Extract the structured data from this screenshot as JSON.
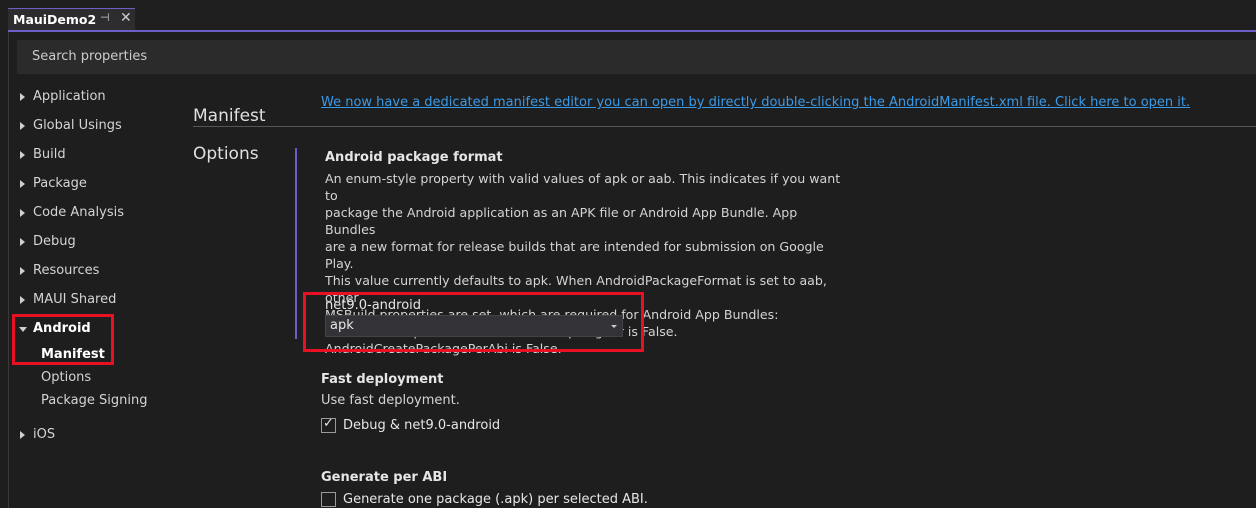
{
  "tab": {
    "title": "MauiDemo2",
    "pin_glyph": "⊣",
    "close_glyph": "✕"
  },
  "search": {
    "placeholder": "Search properties"
  },
  "sidebar": {
    "items": [
      {
        "label": "Application"
      },
      {
        "label": "Global Usings"
      },
      {
        "label": "Build"
      },
      {
        "label": "Package"
      },
      {
        "label": "Code Analysis"
      },
      {
        "label": "Debug"
      },
      {
        "label": "Resources"
      },
      {
        "label": "MAUI Shared"
      },
      {
        "label": "Android"
      },
      {
        "label": "iOS"
      }
    ],
    "android_children": [
      {
        "label": "Manifest"
      },
      {
        "label": "Options"
      },
      {
        "label": "Package Signing"
      }
    ]
  },
  "main": {
    "manifest": {
      "heading": "Manifest",
      "link": "We now have a dedicated manifest editor you can open by directly double-clicking the AndroidManifest.xml file. Click here to open it."
    },
    "options": {
      "heading": "Options",
      "package_format": {
        "title": "Android package format",
        "lines": [
          "An enum-style property with valid values of apk or aab. This indicates if you want to",
          "package the Android application as an APK file or Android App Bundle. App Bundles",
          "are a new format for release builds that are intended for submission on Google Play.",
          "This value currently defaults to apk. When AndroidPackageFormat is set to aab, other",
          "MSBuild properties are set, which are required for Android App Bundles:",
          "AndroidUseAapt2 is True. AndroidUseApkSigner is False.",
          "AndroidCreatePackagePerAbi is False."
        ],
        "target_label": "net9.0-android",
        "selected_value": "apk"
      },
      "fast_deployment": {
        "title": "Fast deployment",
        "description": "Use fast deployment.",
        "checkbox_label": "Debug & net9.0-android",
        "checked": true
      },
      "generate_per_abi": {
        "title": "Generate per ABI",
        "checkbox_label": "Generate one package (.apk) per selected ABI.",
        "checked": false
      }
    }
  },
  "colors": {
    "accent": "#6b5fc7",
    "highlight": "#e81123",
    "link": "#3b9ae8"
  }
}
